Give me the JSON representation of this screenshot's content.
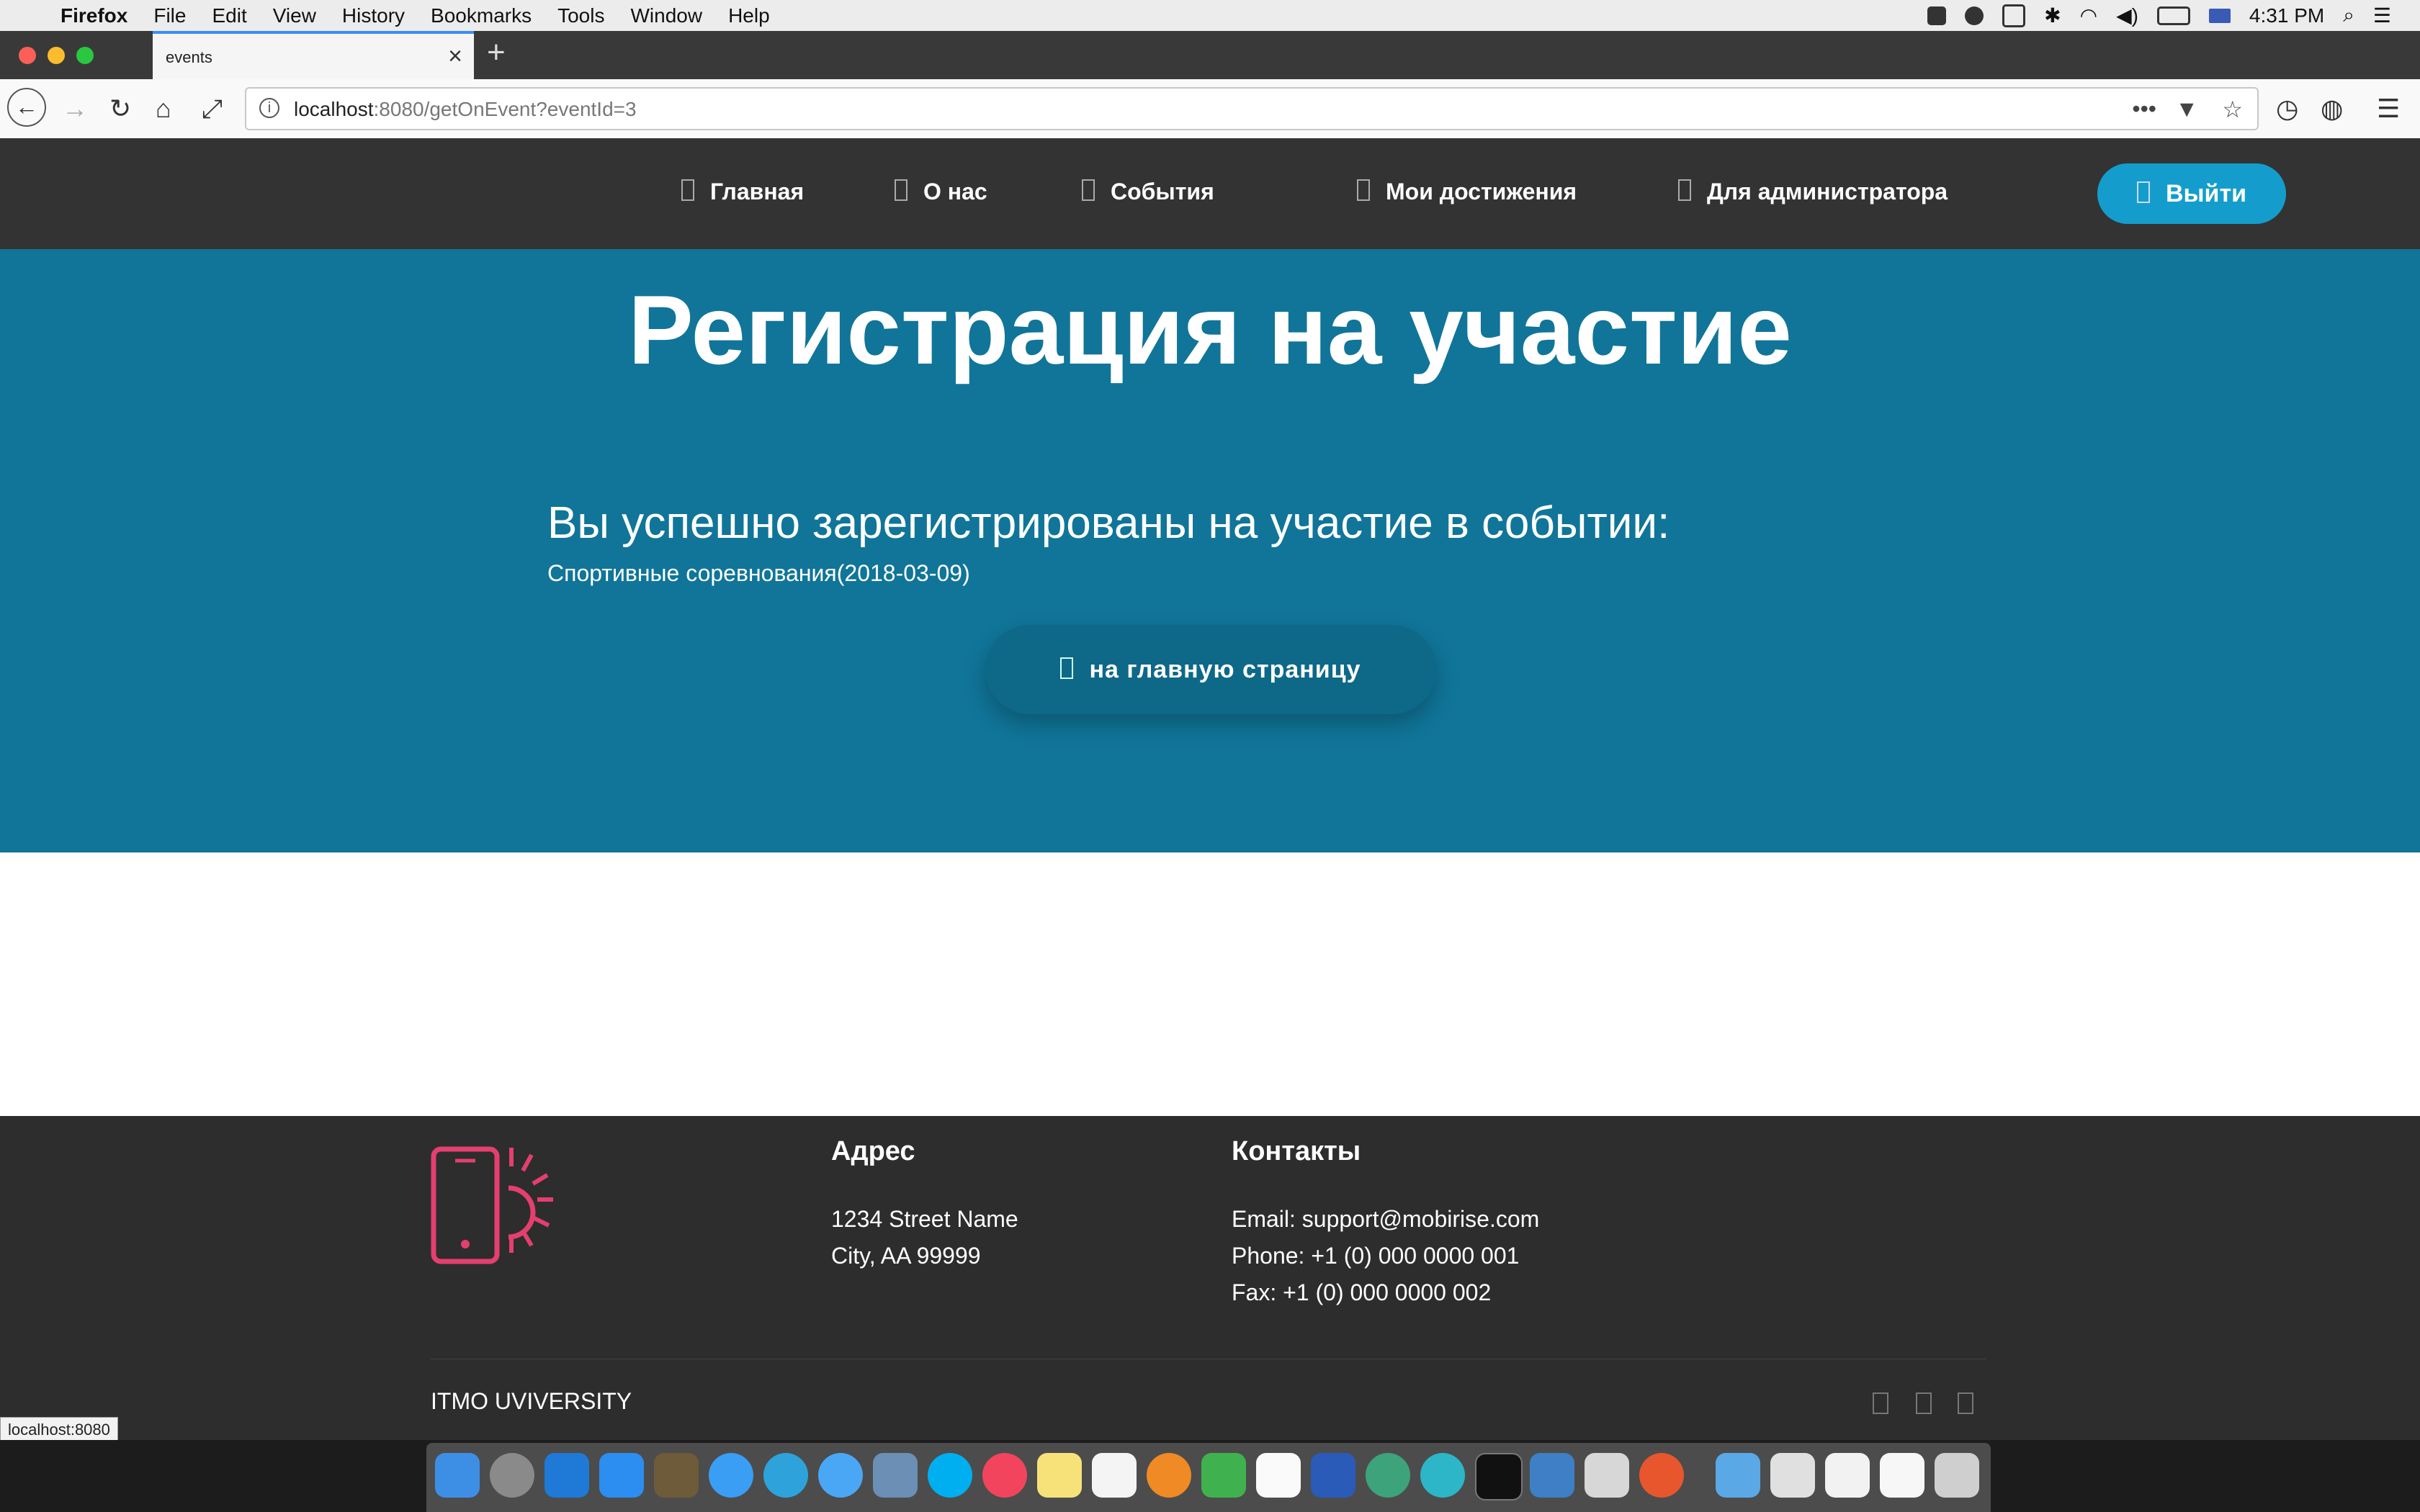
{
  "menubar": {
    "app_name": "Firefox",
    "items": [
      "File",
      "Edit",
      "View",
      "History",
      "Bookmarks",
      "Tools",
      "Window",
      "Help"
    ],
    "clock": "4:31 PM"
  },
  "browser": {
    "tab_title": "events",
    "url_host": "localhost",
    "url_rest": ":8080/getOnEvent?eventId=3",
    "status_tooltip": "localhost:8080"
  },
  "site": {
    "nav": [
      "Главная",
      "О нас",
      "События",
      "Мои достижения",
      "Для администратора"
    ],
    "logout_label": "Выйти",
    "hero_title": "Регистрация на участие",
    "success_message": "Вы успешно зарегистрированы на участие в событии:",
    "event_line": "Спортивные соревнования(2018-03-09)",
    "home_button": "на главную страницу",
    "accent_color": "#107599",
    "button_color": "#149dcc"
  },
  "footer": {
    "address_heading": "Адрес",
    "address_line1": "1234 Street Name",
    "address_line2": "City, AA 99999",
    "contacts_heading": "Контакты",
    "email": "Email: support@mobirise.com",
    "phone": "Phone: +1 (0) 000 0000 001",
    "fax": "Fax: +1 (0) 000 0000 002",
    "copyright": "ITMO UVIVERSITY",
    "logo_color": "#e43f6f"
  }
}
